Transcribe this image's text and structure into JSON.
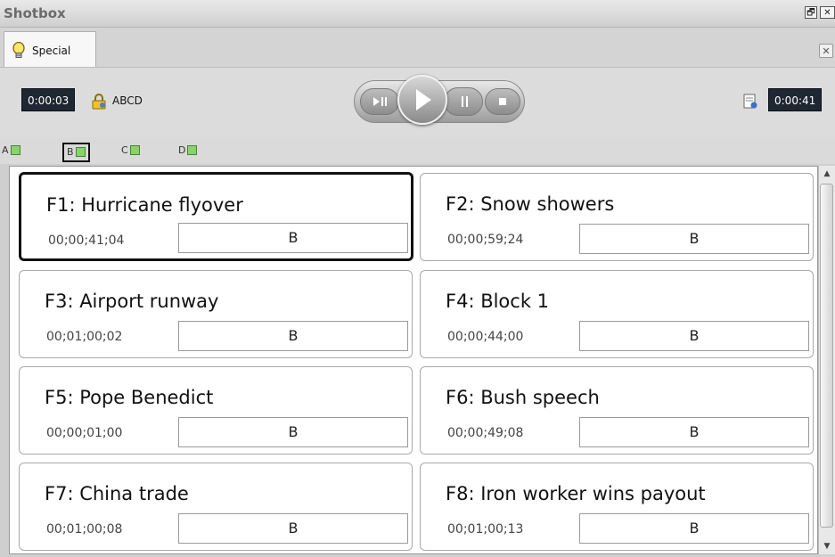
{
  "window": {
    "title": "Shotbox",
    "restore_glyph": "🗗",
    "close_glyph": "✕"
  },
  "tab": {
    "label": "Special",
    "close_glyph": "✕"
  },
  "toolbar": {
    "elapsed": "0:00:03",
    "lock_name": "ABCD",
    "total": "0:00:41"
  },
  "layers": [
    {
      "label": "A",
      "selected": false
    },
    {
      "label": "B",
      "selected": true
    },
    {
      "label": "C",
      "selected": false
    },
    {
      "label": "D",
      "selected": false
    }
  ],
  "cards": [
    {
      "name": "F1: Hurricane flyover",
      "timecode": "00;00;41;04",
      "layer": "B",
      "selected": true
    },
    {
      "name": "F2: Snow showers",
      "timecode": "00;00;59;24",
      "layer": "B",
      "selected": false
    },
    {
      "name": "F3: Airport runway",
      "timecode": "00;01;00;02",
      "layer": "B",
      "selected": false
    },
    {
      "name": "F4: Block 1",
      "timecode": "00;00;44;00",
      "layer": "B",
      "selected": false
    },
    {
      "name": "F5: Pope Benedict",
      "timecode": "00;00;01;00",
      "layer": "B",
      "selected": false
    },
    {
      "name": "F6: Bush speech",
      "timecode": "00;00;49;08",
      "layer": "B",
      "selected": false
    },
    {
      "name": "F7: China trade",
      "timecode": "00;01;00;08",
      "layer": "B",
      "selected": false
    },
    {
      "name": "F8: Iron worker wins payout",
      "timecode": "00;01;00;13",
      "layer": "B",
      "selected": false
    }
  ],
  "icons": {
    "tab": "lightbulb-icon",
    "lock": "lock-icon",
    "report": "report-icon",
    "transport": [
      "play-pause-icon",
      "play-icon",
      "pause-icon",
      "stop-icon"
    ]
  }
}
